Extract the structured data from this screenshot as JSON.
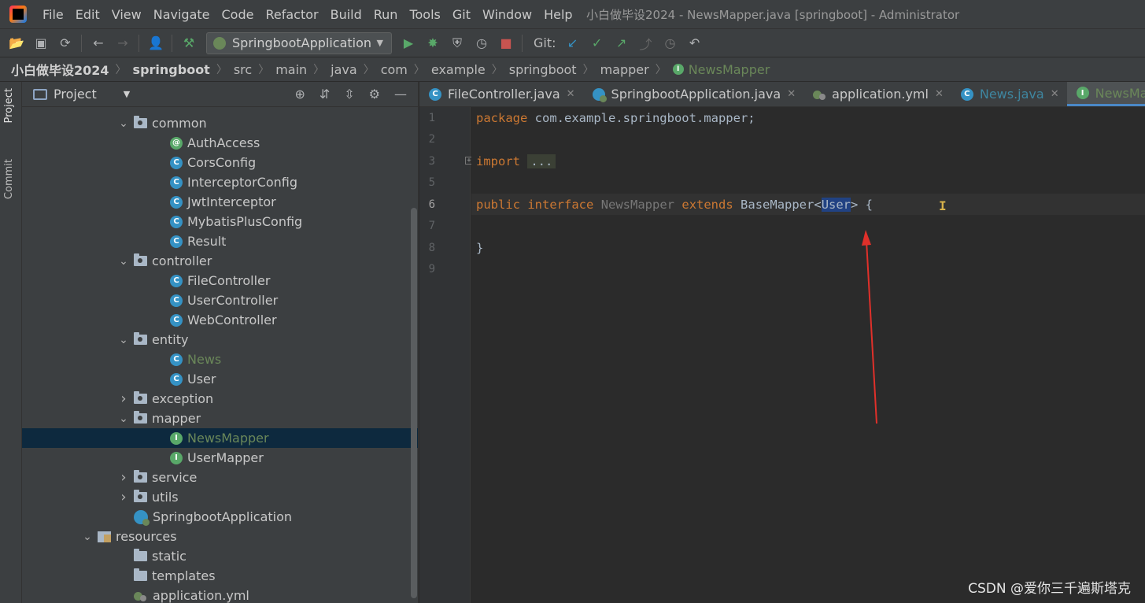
{
  "menubar": {
    "items": [
      "File",
      "Edit",
      "View",
      "Navigate",
      "Code",
      "Refactor",
      "Build",
      "Run",
      "Tools",
      "Git",
      "Window",
      "Help"
    ],
    "window_title": "小白做毕设2024 - NewsMapper.java [springboot] - Administrator"
  },
  "toolbar": {
    "run_config": "SpringbootApplication",
    "git_label": "Git:"
  },
  "breadcrumb": [
    "小白做毕设2024",
    "springboot",
    "src",
    "main",
    "java",
    "com",
    "example",
    "springboot",
    "mapper",
    "NewsMapper"
  ],
  "sidebar": {
    "project_tab": "Project",
    "commit_tab": "Commit"
  },
  "project_panel": {
    "title": "Project"
  },
  "tree": [
    {
      "label": "common",
      "type": "folder",
      "expanded": true,
      "level": 1
    },
    {
      "label": "AuthAccess",
      "type": "annotation",
      "level": 2
    },
    {
      "label": "CorsConfig",
      "type": "class",
      "level": 2
    },
    {
      "label": "InterceptorConfig",
      "type": "class",
      "level": 2
    },
    {
      "label": "JwtInterceptor",
      "type": "class",
      "level": 2
    },
    {
      "label": "MybatisPlusConfig",
      "type": "class",
      "level": 2
    },
    {
      "label": "Result",
      "type": "class",
      "level": 2
    },
    {
      "label": "controller",
      "type": "folder",
      "expanded": true,
      "level": 1
    },
    {
      "label": "FileController",
      "type": "class",
      "level": 2
    },
    {
      "label": "UserController",
      "type": "class",
      "level": 2
    },
    {
      "label": "WebController",
      "type": "class",
      "level": 2
    },
    {
      "label": "entity",
      "type": "folder",
      "expanded": true,
      "level": 1
    },
    {
      "label": "News",
      "type": "class",
      "level": 2,
      "green": true
    },
    {
      "label": "User",
      "type": "class",
      "level": 2
    },
    {
      "label": "exception",
      "type": "folder",
      "expanded": false,
      "level": 1
    },
    {
      "label": "mapper",
      "type": "folder",
      "expanded": true,
      "level": 1
    },
    {
      "label": "NewsMapper",
      "type": "interface",
      "level": 2,
      "green": true,
      "selected": true
    },
    {
      "label": "UserMapper",
      "type": "interface",
      "level": 2
    },
    {
      "label": "service",
      "type": "folder",
      "expanded": false,
      "level": 1
    },
    {
      "label": "utils",
      "type": "folder",
      "expanded": false,
      "level": 1
    },
    {
      "label": "SpringbootApplication",
      "type": "spring",
      "level": 1
    },
    {
      "label": "resources",
      "type": "resfolder",
      "expanded": true,
      "level": 0
    },
    {
      "label": "static",
      "type": "plainfolder",
      "level": 1
    },
    {
      "label": "templates",
      "type": "plainfolder",
      "level": 1
    },
    {
      "label": "application.yml",
      "type": "yml",
      "level": 1
    }
  ],
  "tabs": [
    {
      "label": "FileController.java",
      "icon": "class"
    },
    {
      "label": "SpringbootApplication.java",
      "icon": "spring"
    },
    {
      "label": "application.yml",
      "icon": "yml"
    },
    {
      "label": "News.java",
      "icon": "class",
      "blue": true
    },
    {
      "label": "NewsMapper.java",
      "icon": "interface",
      "active": true
    }
  ],
  "editor": {
    "line_numbers": [
      "1",
      "2",
      "3",
      "5",
      "6",
      "7",
      "8",
      "9"
    ],
    "line1_kw": "package",
    "line1_rest": " com.example.springboot.mapper;",
    "line3_kw": "import",
    "line3_fold": "...",
    "line6_kw1": "public",
    "line6_kw2": "interface",
    "line6_name": "NewsMapper",
    "line6_kw3": "extends",
    "line6_base": "BaseMapper<",
    "line6_sel": "User",
    "line6_end": "> {",
    "line8": "}"
  },
  "watermark": "CSDN @爱你三千遍斯塔克",
  "colors": {
    "keyword": "#cc7832",
    "selection": "#214283",
    "annotation_arrow": "#e0302a"
  }
}
